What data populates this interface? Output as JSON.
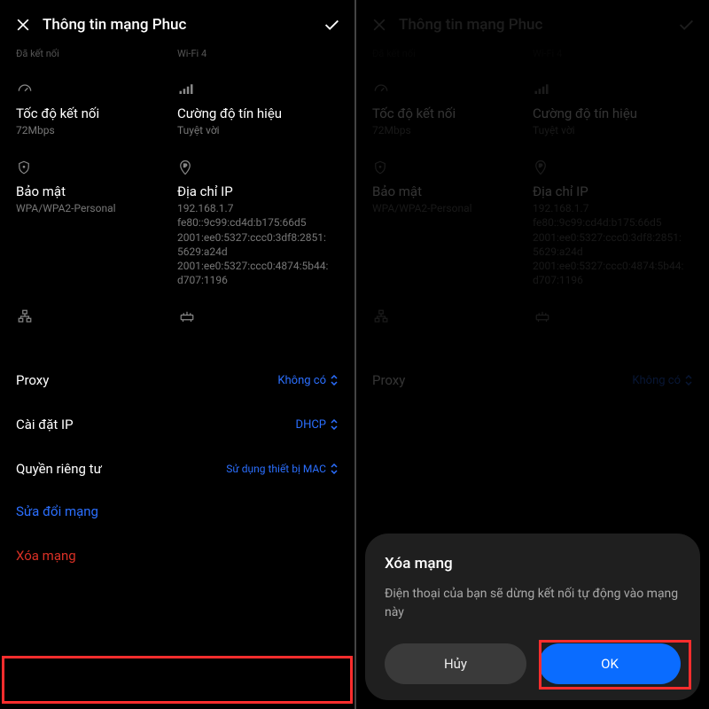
{
  "left": {
    "header": {
      "title": "Thông tin mạng Phuc"
    },
    "cutoff": {
      "a": "Đã kết nối",
      "b": "Wi-Fi 4"
    },
    "speed": {
      "label": "Tốc độ kết nối",
      "value": "72Mbps"
    },
    "signal": {
      "label": "Cường độ tín hiệu",
      "value": "Tuyệt vời"
    },
    "security": {
      "label": "Bảo mật",
      "value": "WPA/WPA2-Personal"
    },
    "ip": {
      "label": "Địa chỉ IP",
      "value": "192.168.1.7\nfe80::9c99:cd4d:b175:66d5\n2001:ee0:5327:ccc0:3df8:2851:5629:a24d\n2001:ee0:5327:ccc0:4874:5b44:d707:1196"
    },
    "proxy": {
      "label": "Proxy",
      "value": "Không có"
    },
    "ipset": {
      "label": "Cài đặt IP",
      "value": "DHCP"
    },
    "privacy": {
      "label": "Quyền riêng tư",
      "value": "Sử dụng thiết bị MAC"
    },
    "modify": {
      "label": "Sửa đổi mạng"
    },
    "forget": {
      "label": "Xóa mạng"
    }
  },
  "right": {
    "header": {
      "title": "Thông tin mạng Phuc"
    },
    "cutoff": {
      "a": "Đã kết nối",
      "b": "Wi-Fi 4"
    },
    "speed": {
      "label": "Tốc độ kết nối",
      "value": "72Mbps"
    },
    "signal": {
      "label": "Cường độ tín hiệu",
      "value": "Tuyệt vời"
    },
    "security": {
      "label": "Bảo mật",
      "value": "WPA/WPA2-Personal"
    },
    "ip": {
      "label": "Địa chỉ IP",
      "value": "192.168.1.7\nfe80::9c99:cd4d:b175:66d5\n2001:ee0:5327:ccc0:3df8:2851:5629:a24d\n2001:ee0:5327:ccc0:4874:5b44:d707:1196"
    },
    "proxy": {
      "label": "Proxy",
      "value": "Không có"
    },
    "dialog": {
      "title": "Xóa mạng",
      "message": "Điện thoại của bạn sẽ dừng kết nối tự động vào mạng này",
      "cancel": "Hủy",
      "ok": "OK"
    }
  }
}
